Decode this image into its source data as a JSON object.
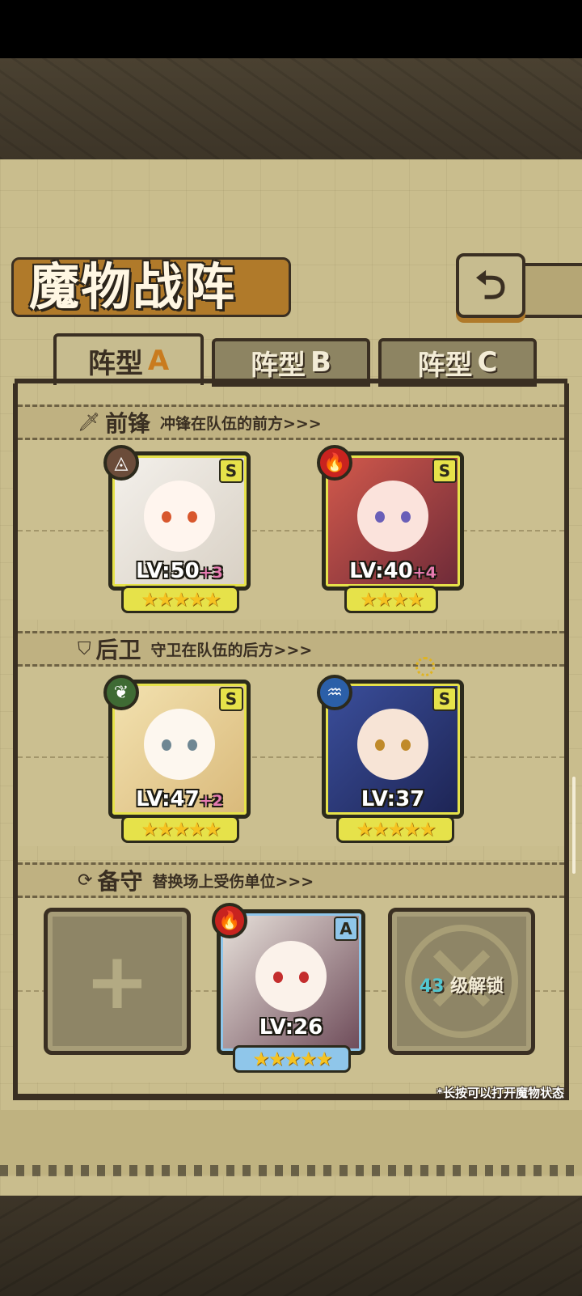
{
  "title": "魔物战阵",
  "back_button_icon": "back-arrow-icon",
  "tabs": [
    {
      "label": "阵型",
      "letter": "A",
      "active": true
    },
    {
      "label": "阵型",
      "letter": "B",
      "active": false
    },
    {
      "label": "阵型",
      "letter": "C",
      "active": false
    }
  ],
  "sections": {
    "front": {
      "icon": "sword-icon",
      "name": "前锋",
      "desc": "冲锋在队伍的前方>>>"
    },
    "rear": {
      "icon": "shield-icon",
      "name": "后卫",
      "desc": "守卫在队伍的后方>>>"
    },
    "reserve": {
      "icon": "swap-icon",
      "name": "备守",
      "desc": "替换场上受伤单位>>>"
    }
  },
  "units": {
    "front_1": {
      "rank": "S",
      "lv": "LV:50",
      "bonus": "+3",
      "element": "earth-element-icon",
      "element_color": "#6b4c3a",
      "stars": "★★★★★",
      "star_count": 5
    },
    "front_2": {
      "rank": "S",
      "lv": "LV:40",
      "bonus": "+4",
      "element": "fire-element-icon",
      "element_color": "#c8231f",
      "stars": "★★★★",
      "star_count": 4
    },
    "rear_1": {
      "rank": "S",
      "lv": "LV:47",
      "bonus": "+2",
      "element": "nature-element-icon",
      "element_color": "#3f6b34",
      "stars": "★★★★★",
      "star_count": 5
    },
    "rear_2": {
      "rank": "S",
      "lv": "LV:37",
      "bonus": "",
      "element": "water-element-icon",
      "element_color": "#2b5fa8",
      "stars": "★★★★★",
      "star_count": 5
    },
    "reserve_2": {
      "rank": "A",
      "lv": "LV:26",
      "bonus": "",
      "element": "fire-element-icon",
      "element_color": "#c8231f",
      "stars": "★★★★★",
      "star_count": 5
    }
  },
  "reserve_slot_3": {
    "level": "43",
    "text": "级解锁"
  },
  "hint": "*长按可以打开魔物状态",
  "colors": {
    "panel": "#c9bd8d",
    "frame": "#3a2f22",
    "card_border": "#e6e24a",
    "reserve_card_border": "#8fc6ea"
  }
}
